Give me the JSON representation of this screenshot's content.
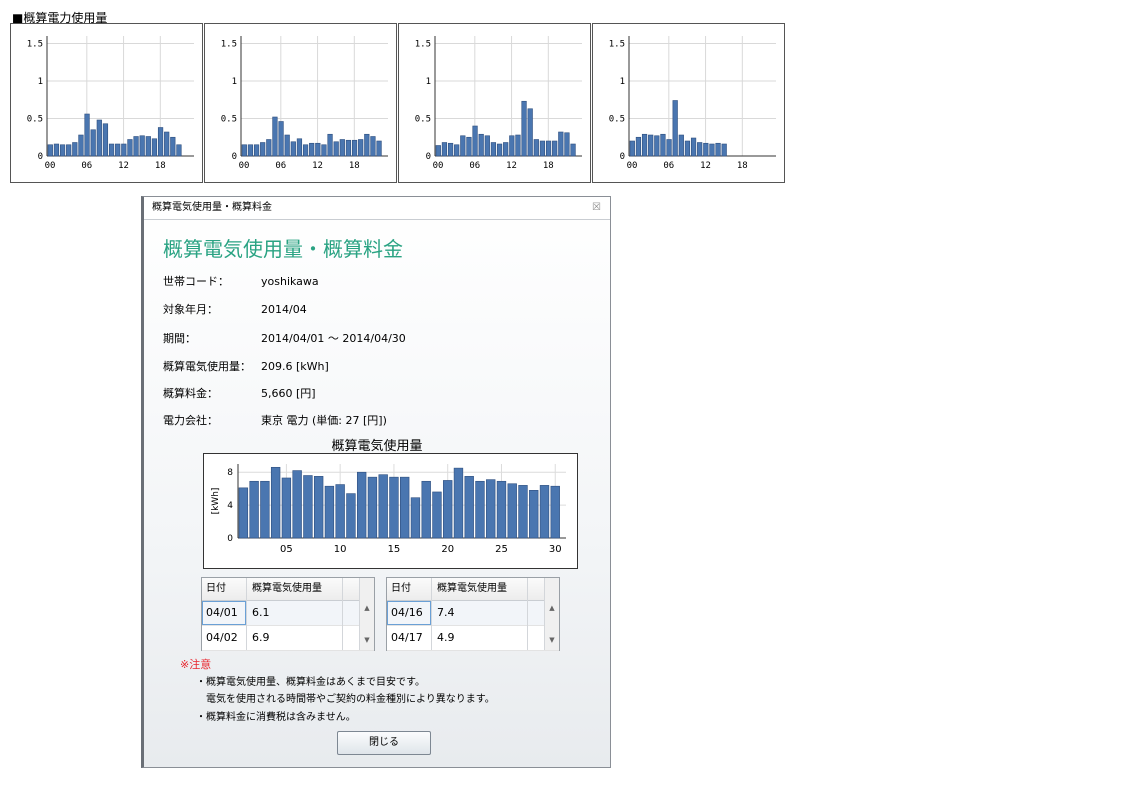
{
  "page_title": "■概算電力使用量",
  "mini_charts": [
    {
      "yticks": [
        "1.5",
        "1",
        "0.5",
        "0"
      ],
      "xticks": [
        "00",
        "06",
        "12",
        "18"
      ],
      "values": [
        0.15,
        0.16,
        0.15,
        0.15,
        0.18,
        0.28,
        0.56,
        0.35,
        0.48,
        0.43,
        0.16,
        0.16,
        0.16,
        0.22,
        0.26,
        0.27,
        0.26,
        0.23,
        0.38,
        0.32,
        0.25,
        0.15
      ]
    },
    {
      "yticks": [
        "1.5",
        "1",
        "0.5",
        "0"
      ],
      "xticks": [
        "00",
        "06",
        "12",
        "18"
      ],
      "values": [
        0.15,
        0.15,
        0.15,
        0.18,
        0.22,
        0.52,
        0.46,
        0.28,
        0.19,
        0.23,
        0.15,
        0.17,
        0.17,
        0.15,
        0.29,
        0.19,
        0.22,
        0.21,
        0.21,
        0.22,
        0.29,
        0.26,
        0.2
      ]
    },
    {
      "yticks": [
        "1.5",
        "1",
        "0.5",
        "0"
      ],
      "xticks": [
        "00",
        "06",
        "12",
        "18"
      ],
      "values": [
        0.14,
        0.18,
        0.17,
        0.15,
        0.27,
        0.25,
        0.4,
        0.29,
        0.27,
        0.18,
        0.16,
        0.18,
        0.27,
        0.28,
        0.73,
        0.63,
        0.22,
        0.2,
        0.2,
        0.2,
        0.32,
        0.31,
        0.16
      ]
    },
    {
      "yticks": [
        "1.5",
        "1",
        "0.5",
        "0"
      ],
      "xticks": [
        "00",
        "06",
        "12",
        "18"
      ],
      "values": [
        0.2,
        0.25,
        0.29,
        0.28,
        0.27,
        0.29,
        0.22,
        0.74,
        0.28,
        0.2,
        0.24,
        0.18,
        0.17,
        0.16,
        0.17,
        0.16,
        0,
        0,
        0,
        0,
        0,
        0,
        0
      ]
    }
  ],
  "dialog": {
    "titlebar": "概算電気使用量・概算料金",
    "close_glyph": "☒",
    "heading": "概算電気使用量・概算料金",
    "rows": [
      {
        "label": "世帯コード：",
        "value": "yoshikawa"
      },
      {
        "label": "対象年月：",
        "value": "2014/04"
      },
      {
        "label": "期間：",
        "value": "2014/04/01 ～ 2014/04/30"
      },
      {
        "label": "概算電気使用量：",
        "value": "209.6 [kWh]"
      },
      {
        "label": "概算料金：",
        "value": "5,660 [円]"
      },
      {
        "label": "電力会社：",
        "value": "東京 電力 (単価: 27 [円])"
      }
    ],
    "chart_title": "概算電気使用量",
    "table_left": {
      "headers": [
        "日付",
        "概算電気使用量"
      ],
      "rows": [
        [
          "04/01",
          "6.1"
        ],
        [
          "04/02",
          "6.9"
        ]
      ]
    },
    "table_right": {
      "headers": [
        "日付",
        "概算電気使用量"
      ],
      "rows": [
        [
          "04/16",
          "7.4"
        ],
        [
          "04/17",
          "4.9"
        ]
      ]
    },
    "notice_heading": "※注意",
    "notices": [
      "・概算電気使用量、概算料金はあくまで目安です。",
      "電気を使用される時間帯やご契約の料金種別により異なります。",
      "・概算料金に消費税は含みません。"
    ],
    "close_label": "閉じる"
  },
  "chart_data": {
    "type": "bar",
    "title": "概算電気使用量",
    "ylabel": "[kWh]",
    "xlabel": "",
    "ylim": [
      0,
      9
    ],
    "xticks": [
      "05",
      "10",
      "15",
      "20",
      "25",
      "30"
    ],
    "yticks": [
      "8",
      "4",
      "0"
    ],
    "x": [
      1,
      2,
      3,
      4,
      5,
      6,
      7,
      8,
      9,
      10,
      11,
      12,
      13,
      14,
      15,
      16,
      17,
      18,
      19,
      20,
      21,
      22,
      23,
      24,
      25,
      26,
      27,
      28,
      29,
      30
    ],
    "values": [
      6.1,
      6.9,
      6.9,
      8.6,
      7.3,
      8.2,
      7.6,
      7.5,
      6.3,
      6.5,
      5.4,
      8.0,
      7.4,
      7.7,
      7.4,
      7.4,
      4.9,
      6.9,
      5.6,
      7.0,
      8.5,
      7.5,
      6.9,
      7.1,
      6.9,
      6.6,
      6.4,
      5.8,
      6.4,
      6.3
    ],
    "grid": true
  }
}
